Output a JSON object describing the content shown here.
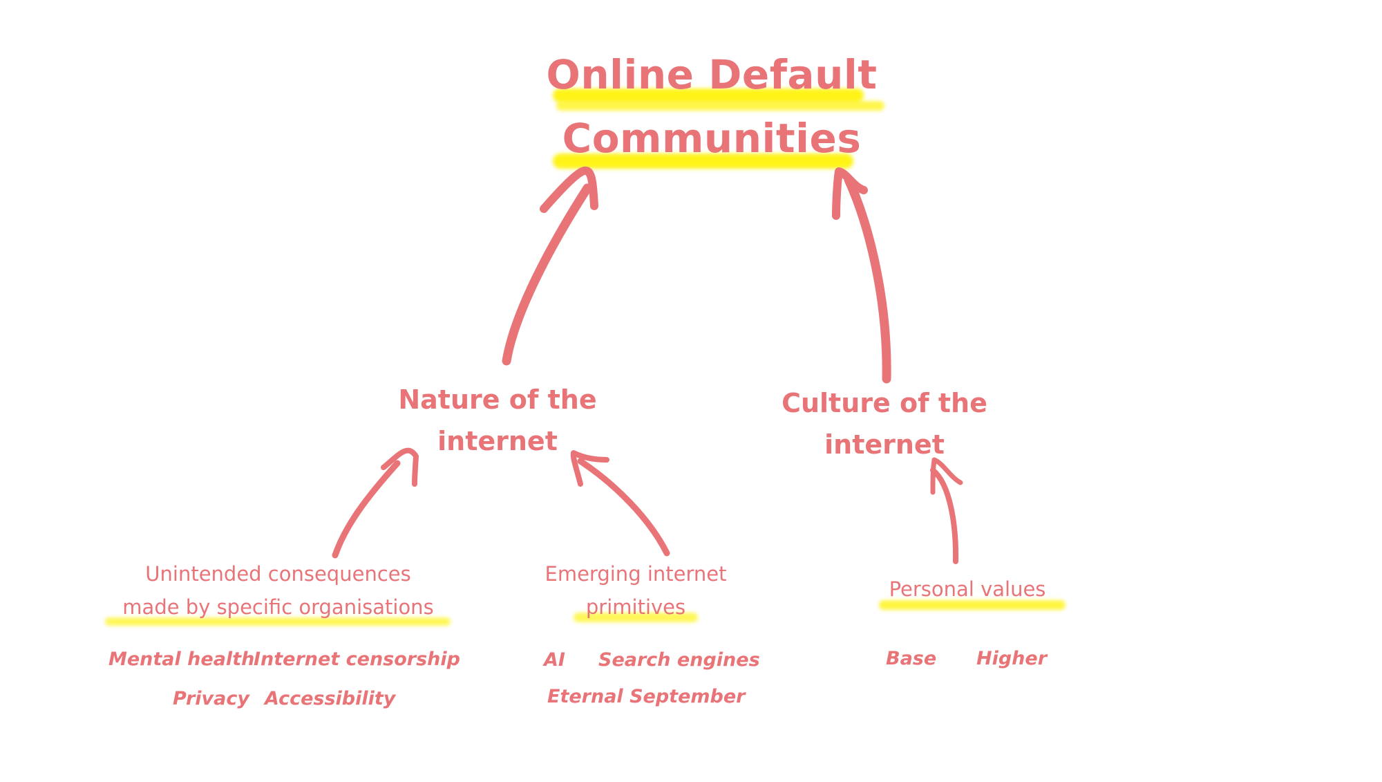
{
  "colors": {
    "ink": "#e87478",
    "highlight": "#fff200",
    "background": "#ffffff"
  },
  "title": {
    "line1": "Online Default",
    "line2": "Communities"
  },
  "nodes": {
    "nature": {
      "line1": "Nature of the",
      "line2": "internet"
    },
    "culture": {
      "line1": "Culture of the",
      "line2": "internet"
    },
    "unintended": {
      "line1": "Unintended consequences",
      "line2": "made by specific organisations"
    },
    "emerging": {
      "line1": "Emerging internet",
      "line2": "primitives"
    },
    "personal": {
      "line1": "Personal values"
    }
  },
  "examples": {
    "unintended": [
      "Mental health",
      "Internet censorship",
      "Privacy",
      "Accessibility"
    ],
    "emerging": [
      "AI",
      "Search engines",
      "Eternal September"
    ],
    "personal": [
      "Base",
      "Higher"
    ]
  },
  "edges": [
    {
      "from": "nature",
      "to": "title"
    },
    {
      "from": "culture",
      "to": "title"
    },
    {
      "from": "unintended",
      "to": "nature"
    },
    {
      "from": "emerging",
      "to": "nature"
    },
    {
      "from": "personal",
      "to": "culture"
    }
  ]
}
